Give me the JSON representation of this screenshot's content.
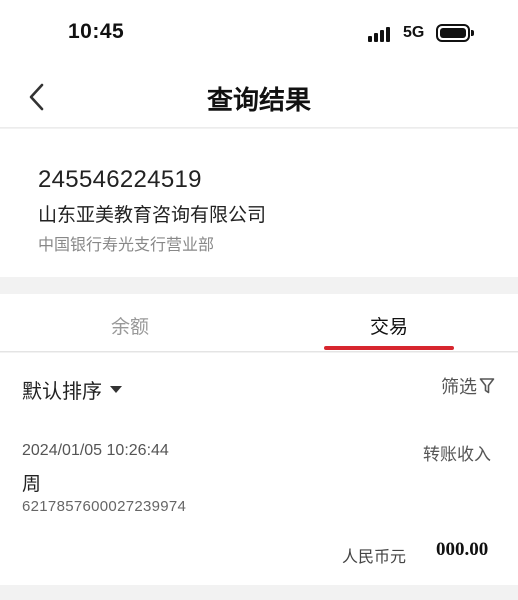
{
  "status_bar": {
    "time": "10:45",
    "network": "5G"
  },
  "nav": {
    "title": "查询结果",
    "back_icon": "chevron-left-icon"
  },
  "account": {
    "number": "245546224519",
    "name": "山东亚美教育咨询有限公司",
    "branch": "中国银行寿光支行营业部"
  },
  "tabs": [
    {
      "label": "余额",
      "active": false
    },
    {
      "label": "交易",
      "active": true
    }
  ],
  "accent_color": "#d7262e",
  "filters": {
    "sort_label": "默认排序",
    "filter_label": "筛选",
    "filter_icon": "funnel-icon"
  },
  "transactions": [
    {
      "time": "2024/01/05 10:26:44",
      "type": "转账收入",
      "name": "周",
      "account": "6217857600027239974",
      "currency": "人民币元",
      "amount": "000.00"
    }
  ]
}
